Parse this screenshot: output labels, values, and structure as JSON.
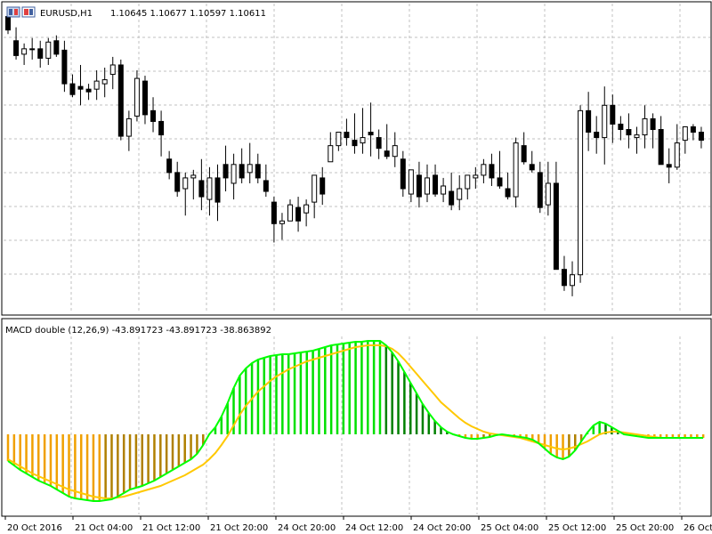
{
  "header": {
    "symbol": "EURUSD,H1",
    "ohlc": "1.10645 1.10677 1.10597 1.10611"
  },
  "indicator": {
    "label": "MACD double (12,26,9) -43.891723 -43.891723 -38.863892"
  },
  "x_axis": {
    "labels": [
      "20 Oct 2016",
      "21 Oct 04:00",
      "21 Oct 12:00",
      "21 Oct 20:00",
      "24 Oct 20:00",
      "24 Oct 12:00",
      "24 Oct 20:00",
      "25 Oct 04:00",
      "25 Oct 12:00",
      "25 Oct 20:00",
      "26 Oct 0"
    ]
  },
  "colors": {
    "background": "#ffffff",
    "grid": "#c0c0c0",
    "frame": "#000000",
    "bull_candle": "#ffffff",
    "bear_candle": "#000000",
    "hist_up_above": "#00e000",
    "hist_down_above": "#008000",
    "hist_down_below": "#f0a000",
    "hist_up_below": "#b08000",
    "macd_line": "#00ff00",
    "signal_line": "#ffc800"
  },
  "chart_data": [
    {
      "type": "candlestick",
      "title": "EURUSD,H1",
      "ohlc_header": [
        1.10645,
        1.10677,
        1.10597,
        1.10611
      ],
      "y_unit": "price index (relative)",
      "ylim": [
        0,
        100
      ],
      "candles": [
        [
          98,
          100,
          85,
          88
        ],
        [
          80,
          90,
          66,
          69
        ],
        [
          70,
          78,
          62,
          74
        ],
        [
          74,
          82,
          66,
          74
        ],
        [
          74,
          80,
          60,
          67
        ],
        [
          67,
          82,
          62,
          79
        ],
        [
          80,
          84,
          68,
          70
        ],
        [
          73,
          80,
          42,
          48
        ],
        [
          48,
          55,
          38,
          40
        ],
        [
          46,
          62,
          32,
          44
        ],
        [
          44,
          48,
          36,
          42
        ],
        [
          44,
          58,
          36,
          50
        ],
        [
          48,
          60,
          38,
          51
        ],
        [
          55,
          68,
          44,
          62
        ],
        [
          62,
          66,
          6,
          9
        ],
        [
          9,
          28,
          -2,
          22
        ],
        [
          24,
          58,
          20,
          52
        ],
        [
          50,
          54,
          18,
          25
        ],
        [
          28,
          38,
          12,
          20
        ],
        [
          20,
          28,
          -6,
          10
        ],
        [
          -8,
          -2,
          -23,
          -18
        ],
        [
          -18,
          -10,
          -36,
          -32
        ],
        [
          -30,
          -18,
          -50,
          -22
        ],
        [
          -22,
          -16,
          -38,
          -20
        ],
        [
          -24,
          -8,
          -46,
          -36
        ],
        [
          -38,
          -14,
          -50,
          -22
        ],
        [
          -22,
          -12,
          -54,
          -40
        ],
        [
          -12,
          2,
          -32,
          -22
        ],
        [
          -26,
          -4,
          -38,
          -12
        ],
        [
          -12,
          0,
          -26,
          -22
        ],
        [
          -18,
          4,
          -26,
          -12
        ],
        [
          -12,
          -4,
          -26,
          -22
        ],
        [
          -24,
          -12,
          -36,
          -32
        ],
        [
          -40,
          -36,
          -70,
          -56
        ],
        [
          -56,
          -48,
          -68,
          -54
        ],
        [
          -54,
          -38,
          -52,
          -42
        ],
        [
          -44,
          -36,
          -62,
          -54
        ],
        [
          -48,
          -38,
          -58,
          -42
        ],
        [
          -40,
          -20,
          -52,
          -20
        ],
        [
          -22,
          -14,
          -42,
          -34
        ],
        [
          -10,
          -10,
          12,
          2
        ],
        [
          2,
          12,
          -2,
          12
        ],
        [
          12,
          22,
          2,
          8
        ],
        [
          6,
          26,
          -4,
          2
        ],
        [
          4,
          30,
          -4,
          8
        ],
        [
          12,
          34,
          -6,
          10
        ],
        [
          8,
          14,
          -8,
          0
        ],
        [
          -2,
          18,
          -8,
          -6
        ],
        [
          -6,
          12,
          -14,
          2
        ],
        [
          -8,
          -2,
          -36,
          -30
        ],
        [
          -34,
          -18,
          -40,
          -16
        ],
        [
          -20,
          -10,
          -44,
          -36
        ],
        [
          -34,
          -12,
          -40,
          -22
        ],
        [
          -20,
          -12,
          -36,
          -34
        ],
        [
          -34,
          -22,
          -40,
          -28
        ],
        [
          -32,
          -18,
          -46,
          -42
        ],
        [
          -38,
          -20,
          -46,
          -30
        ],
        [
          -30,
          -20,
          -38,
          -20
        ],
        [
          -22,
          -14,
          -30,
          -20
        ],
        [
          -20,
          -8,
          -26,
          -12
        ],
        [
          -12,
          -4,
          -28,
          -22
        ],
        [
          -22,
          -2,
          -30,
          -28
        ],
        [
          -30,
          -18,
          -38,
          -36
        ],
        [
          -36,
          8,
          -44,
          4
        ],
        [
          2,
          12,
          -12,
          -10
        ],
        [
          -12,
          -2,
          -18,
          -16
        ],
        [
          -18,
          -10,
          -48,
          -44
        ],
        [
          -42,
          -10,
          -50,
          -26
        ],
        [
          -26,
          -10,
          -90,
          -90
        ],
        [
          -90,
          -80,
          -106,
          -102
        ],
        [
          -102,
          -84,
          -110,
          -94
        ],
        [
          -94,
          32,
          -100,
          28
        ],
        [
          28,
          42,
          -2,
          12
        ],
        [
          12,
          24,
          -4,
          8
        ],
        [
          8,
          46,
          -12,
          32
        ],
        [
          32,
          40,
          4,
          18
        ],
        [
          18,
          24,
          6,
          14
        ],
        [
          14,
          26,
          0,
          10
        ],
        [
          8,
          16,
          -4,
          10
        ],
        [
          10,
          32,
          0,
          22
        ],
        [
          22,
          26,
          0,
          14
        ],
        [
          14,
          24,
          -4,
          -12
        ],
        [
          -12,
          0,
          -26,
          -14
        ],
        [
          -14,
          18,
          -16,
          4
        ],
        [
          6,
          14,
          -4,
          16
        ],
        [
          16,
          18,
          6,
          12
        ],
        [
          12,
          16,
          0,
          6
        ]
      ]
    },
    {
      "type": "macd",
      "title": "MACD double (12,26,9)",
      "values_header": [
        -43.891723,
        -43.891723,
        -38.863892
      ],
      "ylim": [
        -90,
        110
      ],
      "series": [
        {
          "name": "histogram",
          "values": [
            -30,
            -35,
            -40,
            -44,
            -48,
            -52,
            -55,
            -58,
            -62,
            -66,
            -70,
            -72,
            -73,
            -74,
            -75,
            -75,
            -74,
            -73,
            -70,
            -66,
            -62,
            -60,
            -58,
            -55,
            -52,
            -48,
            -44,
            -40,
            -36,
            -32,
            -28,
            -22,
            -12,
            0,
            8,
            20,
            35,
            52,
            66,
            74,
            80,
            84,
            86,
            88,
            89,
            90,
            90,
            91,
            92,
            93,
            94,
            96,
            98,
            100,
            101,
            102,
            103,
            104,
            104,
            105,
            105,
            105,
            100,
            92,
            82,
            70,
            58,
            46,
            34,
            24,
            15,
            8,
            3,
            0,
            -2,
            -4,
            -5,
            -5,
            -4,
            -3,
            -1,
            0,
            -1,
            -2,
            -3,
            -4,
            -6,
            -10,
            -16,
            -22,
            -26,
            -28,
            -25,
            -18,
            -8,
            2,
            10,
            14,
            12,
            8,
            4,
            0,
            -1,
            -2,
            -3,
            -4,
            -4,
            -4,
            -4,
            -4,
            -4,
            -4,
            -4,
            -4,
            -4
          ]
        },
        {
          "name": "signal",
          "values": [
            -28,
            -32,
            -36,
            -40,
            -44,
            -47,
            -50,
            -53,
            -56,
            -59,
            -62,
            -64,
            -66,
            -68,
            -70,
            -71,
            -72,
            -72,
            -71,
            -70,
            -68,
            -66,
            -64,
            -62,
            -60,
            -58,
            -55,
            -52,
            -49,
            -46,
            -42,
            -38,
            -34,
            -28,
            -21,
            -12,
            -2,
            10,
            22,
            32,
            40,
            48,
            54,
            60,
            65,
            69,
            73,
            76,
            79,
            82,
            84,
            86,
            88,
            90,
            92,
            94,
            96,
            98,
            99,
            100,
            100,
            100,
            99,
            96,
            91,
            84,
            76,
            68,
            60,
            52,
            44,
            36,
            30,
            24,
            18,
            13,
            9,
            6,
            3,
            1,
            0,
            -1,
            -2,
            -3,
            -4,
            -6,
            -8,
            -10,
            -12,
            -14,
            -16,
            -17,
            -16,
            -14,
            -11,
            -8,
            -4,
            0,
            2,
            3,
            3,
            2,
            1,
            0,
            -1,
            -2,
            -3,
            -4,
            -4,
            -4,
            -4,
            -4,
            -4,
            -4
          ]
        }
      ]
    }
  ]
}
